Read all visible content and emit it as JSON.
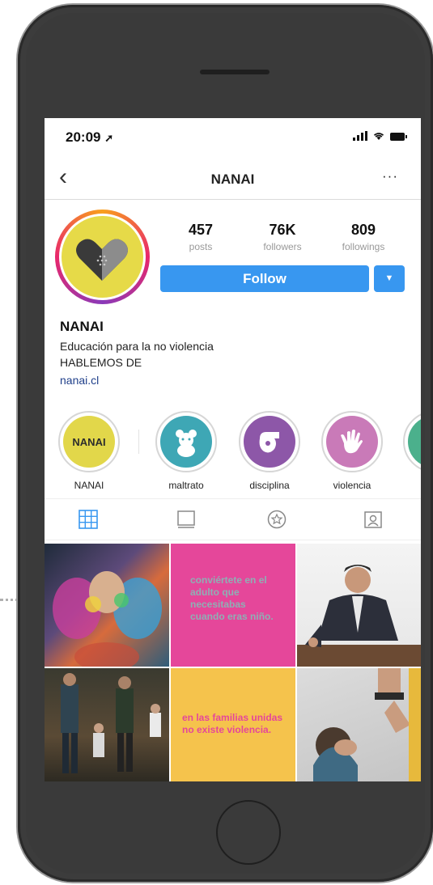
{
  "status": {
    "time": "20:09"
  },
  "nav": {
    "title": "NANAI",
    "more": "···"
  },
  "stats": [
    {
      "value": "457",
      "label": "posts"
    },
    {
      "value": "76K",
      "label": "followers"
    },
    {
      "value": "809",
      "label": "followings"
    }
  ],
  "follow_label": "Follow",
  "profile": {
    "name": "NANAI",
    "bio_line1": "Educación para la no violencia",
    "bio_line2": "HABLEMOS DE",
    "link": "nanai.cl"
  },
  "highlights": [
    {
      "label": "NANAI",
      "inner_text": "NANAI",
      "color": "#e2d74a",
      "icon": "nanai-text-icon"
    },
    {
      "label": "maltrato",
      "color": "#3ea7b5",
      "icon": "teddy-bear-icon"
    },
    {
      "label": "disciplina",
      "color": "#8d57a8",
      "icon": "whistle-icon"
    },
    {
      "label": "violencia",
      "color": "#c97ab8",
      "icon": "hand-icon"
    },
    {
      "label": "",
      "color": "#4bb08c",
      "icon": "partial-highlight-icon"
    }
  ],
  "tabs": [
    "grid-icon",
    "feed-icon",
    "star-icon",
    "tagged-icon"
  ],
  "posts": {
    "post2_text": "conviértete en el adulto que necesitabas cuando eras niño.",
    "post5_text": "en las familias unidas no existe violencia."
  },
  "colors": {
    "accent": "#3897f0",
    "pink": "#e5479a",
    "yellow": "#f5c34c",
    "gridtab": "#3897f0"
  }
}
